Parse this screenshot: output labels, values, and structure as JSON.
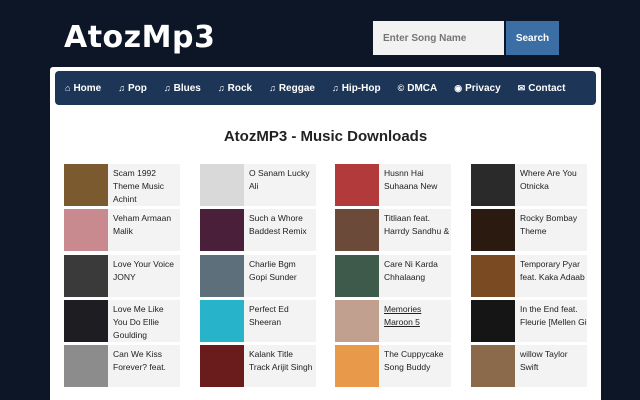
{
  "site": {
    "logo": "AtozMp3",
    "search_placeholder": "Enter Song Name",
    "search_button": "Search"
  },
  "nav": [
    {
      "label": "Home",
      "icon": "home-icon",
      "glyph": "⌂"
    },
    {
      "label": "Pop",
      "icon": "music-icon",
      "glyph": "♫"
    },
    {
      "label": "Blues",
      "icon": "music-icon",
      "glyph": "♫"
    },
    {
      "label": "Rock",
      "icon": "music-icon",
      "glyph": "♫"
    },
    {
      "label": "Reggae",
      "icon": "music-icon",
      "glyph": "♫"
    },
    {
      "label": "Hip-Hop",
      "icon": "music-icon",
      "glyph": "♫"
    },
    {
      "label": "DMCA",
      "icon": "copyright-icon",
      "glyph": "©"
    },
    {
      "label": "Privacy",
      "icon": "eye-icon",
      "glyph": "◉"
    },
    {
      "label": "Contact",
      "icon": "envelope-icon",
      "glyph": "✉"
    }
  ],
  "page_title": "AtozMP3 - Music Downloads",
  "colors": {
    "background": "#0d1626",
    "nav": "#1d3557",
    "search_button": "#3a6ea5"
  },
  "songs": [
    [
      {
        "title": "Scam 1992 Theme Music Achint",
        "thumb": "#7a5a2e"
      },
      {
        "title": "Veham Armaan Malik",
        "thumb": "#c98a8f"
      },
      {
        "title": "Love Your Voice JONY",
        "thumb": "#3a3a3a"
      },
      {
        "title": "Love Me Like You Do Ellie Goulding",
        "thumb": "#1e1e22"
      },
      {
        "title": "Can We Kiss Forever? feat.",
        "thumb": "#8c8c8c"
      }
    ],
    [
      {
        "title": "O Sanam Lucky Ali",
        "thumb": "#d9d9d9"
      },
      {
        "title": "Such a Whore Baddest Remix",
        "thumb": "#4a1f3a"
      },
      {
        "title": "Charlie Bgm Gopi Sunder",
        "thumb": "#5c6f7a"
      },
      {
        "title": "Perfect Ed Sheeran",
        "thumb": "#27b3c9"
      },
      {
        "title": "Kalank Title Track Arijit Singh",
        "thumb": "#6a1c1c"
      }
    ],
    [
      {
        "title": "Husnn Hai Suhaana New",
        "thumb": "#b23a3a"
      },
      {
        "title": "Titliaan feat. Harrdy Sandhu &",
        "thumb": "#6b4a3a"
      },
      {
        "title": "Care Ni Karda Chhalaang",
        "thumb": "#3d5a4a"
      },
      {
        "title": "Memories Maroon 5",
        "thumb": "#c2a090",
        "underline": true
      },
      {
        "title": "The Cuppycake Song Buddy",
        "thumb": "#e89a4a"
      }
    ],
    [
      {
        "title": "Where Are You Otnicka",
        "thumb": "#2a2a2a"
      },
      {
        "title": "Rocky Bombay Theme",
        "thumb": "#2b1a10"
      },
      {
        "title": "Temporary Pyar feat. Kaka Adaab",
        "thumb": "#7a4a22"
      },
      {
        "title": "In the End feat. Fleurie [Mellen Gi",
        "thumb": "#151515"
      },
      {
        "title": "willow Taylor Swift",
        "thumb": "#8a6a4a"
      }
    ]
  ]
}
